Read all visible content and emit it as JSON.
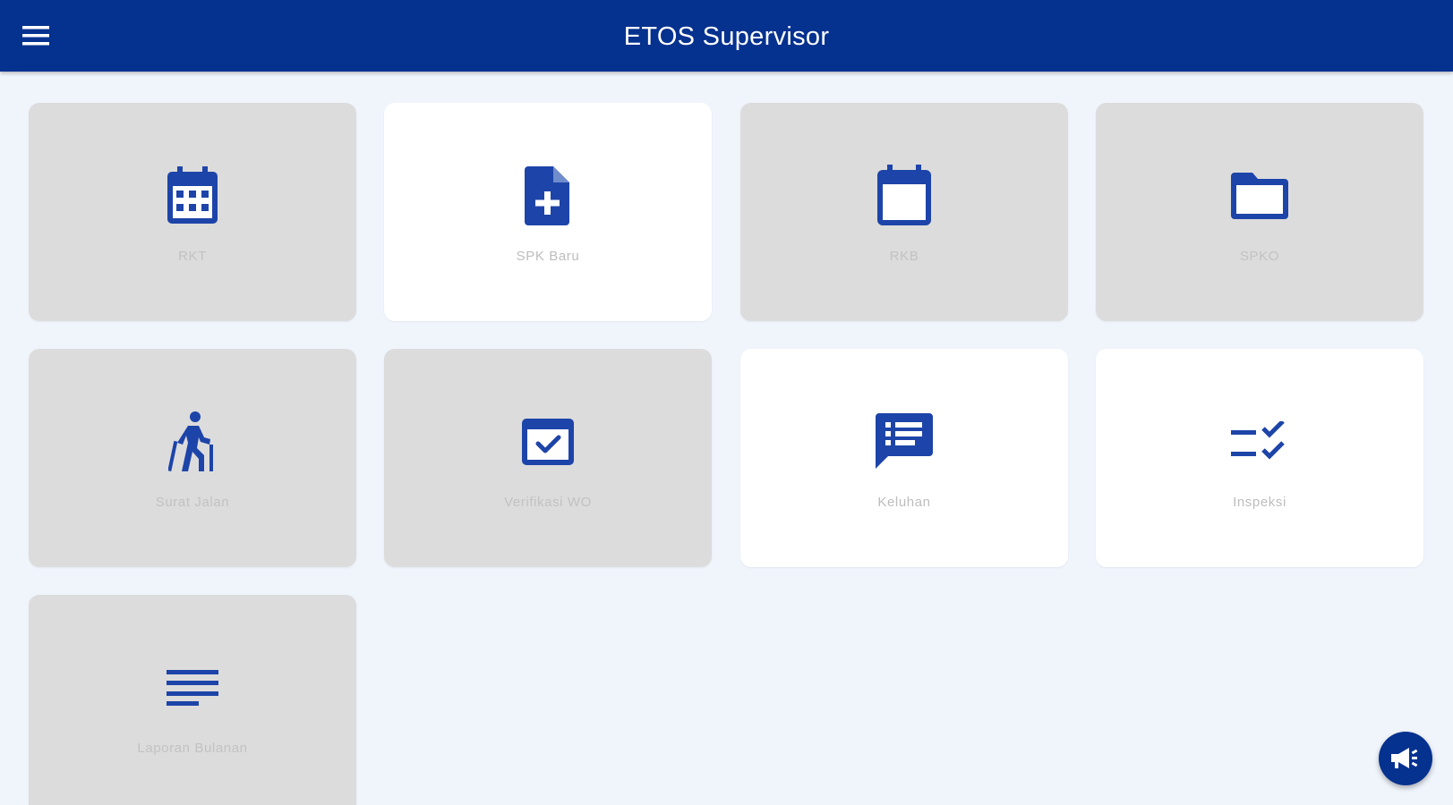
{
  "app": {
    "title": "ETOS Supervisor"
  },
  "colors": {
    "primary": "#05318f",
    "tile_inactive": "#dcdcdc",
    "tile_active": "#ffffff",
    "background": "#f0f5fc",
    "label": "#c2c2c2"
  },
  "header": {
    "menu_icon": "hamburger-menu-icon"
  },
  "tiles": [
    {
      "label": "RKT",
      "icon": "calendar-grid-icon",
      "active": false
    },
    {
      "label": "SPK Baru",
      "icon": "document-plus-icon",
      "active": true
    },
    {
      "label": "RKB",
      "icon": "calendar-icon",
      "active": false
    },
    {
      "label": "SPKO",
      "icon": "folder-icon",
      "active": false
    },
    {
      "label": "Surat Jalan",
      "icon": "hiking-person-icon",
      "active": false
    },
    {
      "label": "Verifikasi WO",
      "icon": "checkbox-icon",
      "active": false
    },
    {
      "label": "Keluhan",
      "icon": "feedback-list-icon",
      "active": true
    },
    {
      "label": "Inspeksi",
      "icon": "checklist-icon",
      "active": true
    },
    {
      "label": "Laporan Bulanan",
      "icon": "lines-icon",
      "active": false
    }
  ],
  "fab": {
    "icon": "megaphone-icon"
  }
}
